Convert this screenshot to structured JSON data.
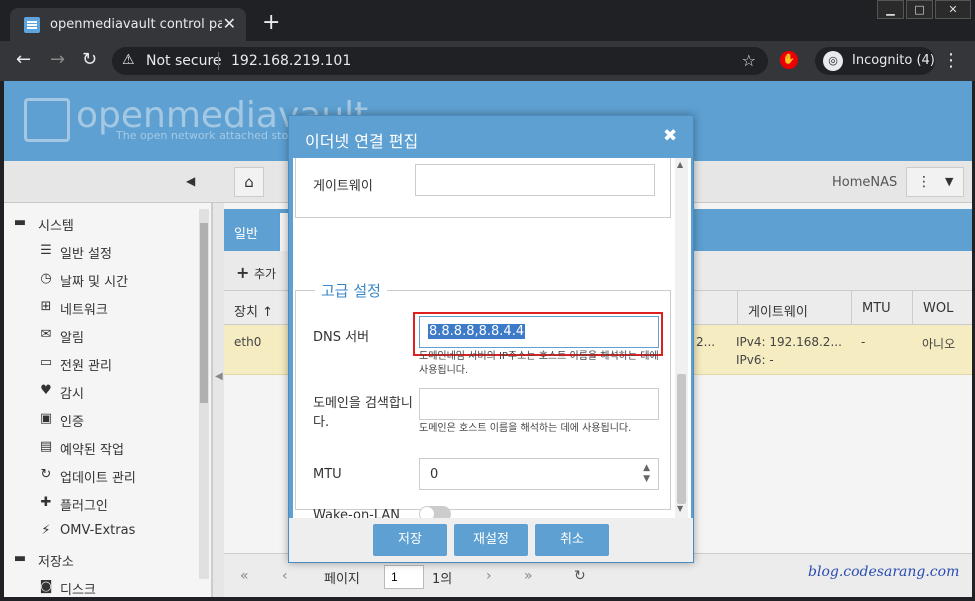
{
  "browser": {
    "tab_title": "openmediavault control panel - l",
    "not_secure": "Not secure",
    "url": "192.168.219.101",
    "incognito": "Incognito (4)"
  },
  "app": {
    "logo": "openmediavault",
    "tagline": "The open network attached stora",
    "hostname": "HomeNAS"
  },
  "sidebar": {
    "items": [
      {
        "label": "시스템",
        "type": "cat",
        "icon": "minus-box-icon"
      },
      {
        "label": "일반 설정",
        "type": "item",
        "icon": "sliders-icon"
      },
      {
        "label": "날짜 및 시간",
        "type": "item",
        "icon": "clock-icon"
      },
      {
        "label": "네트워크",
        "type": "item",
        "icon": "network-icon"
      },
      {
        "label": "알림",
        "type": "item",
        "icon": "envelope-icon"
      },
      {
        "label": "전원 관리",
        "type": "item",
        "icon": "battery-icon"
      },
      {
        "label": "감시",
        "type": "item",
        "icon": "heartbeat-icon"
      },
      {
        "label": "인증",
        "type": "item",
        "icon": "certificate-icon"
      },
      {
        "label": "예약된 작업",
        "type": "item",
        "icon": "calendar-clock-icon"
      },
      {
        "label": "업데이트 관리",
        "type": "item",
        "icon": "refresh-icon"
      },
      {
        "label": "플러그인",
        "type": "item",
        "icon": "puzzle-icon"
      },
      {
        "label": "OMV-Extras",
        "type": "item",
        "icon": "plug-icon"
      },
      {
        "label": "저장소",
        "type": "cat",
        "icon": "minus-box-icon"
      },
      {
        "label": "디스크",
        "type": "item",
        "icon": "disk-icon"
      }
    ]
  },
  "main": {
    "tab_general": "일반",
    "add_label": "추가",
    "columns": {
      "device": "장치",
      "gateway": "게이트웨이",
      "mtu": "MTU",
      "wol": "WOL"
    },
    "row": {
      "device": "eth0",
      "ip_trunc": "2...",
      "gateway_v4": "IPv4: 192.168.2...",
      "gateway_v6": "IPv6: -",
      "mtu": "-",
      "wol": "아니오"
    },
    "pager": {
      "page_label": "페이지",
      "page_value": "1",
      "of": "1의"
    }
  },
  "modal": {
    "title": "이더넷 연결 편집",
    "gateway_label": "게이트웨이",
    "advanced_legend": "고급 설정",
    "dns_label": "DNS 서버",
    "dns_value": "8.8.8.8,8.8.4.4",
    "dns_hint": "도메인네임 서버의 IP주소는 호스트 이름을 해석하는 데에 사용됩니다.",
    "search_label": "도메인을 검색합니다.",
    "search_hint": "도메인은 호스트 이름을 해석하는 데에 사용됩니다.",
    "mtu_label": "MTU",
    "mtu_value": "0",
    "wol_label": "Wake-on-LAN",
    "wol_enabled": false,
    "save": "저장",
    "reset": "재설정",
    "cancel": "취소"
  },
  "watermark": "blog.codesarang.com"
}
